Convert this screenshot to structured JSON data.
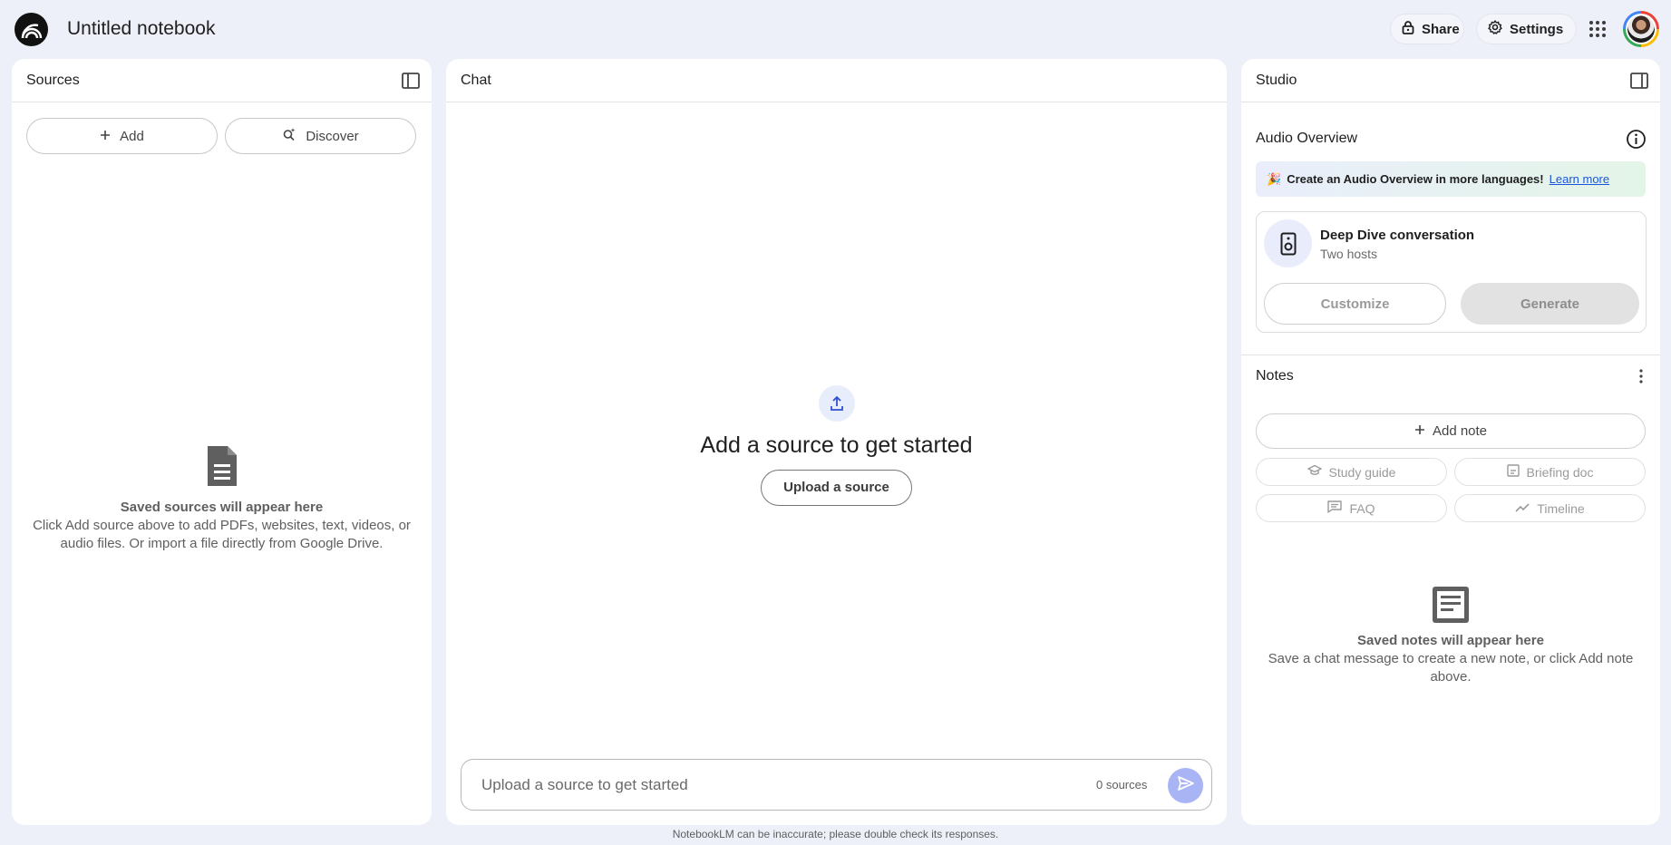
{
  "header": {
    "notebook_title": "Untitled notebook",
    "share_label": "Share",
    "settings_label": "Settings"
  },
  "sources": {
    "title": "Sources",
    "add_label": "Add",
    "discover_label": "Discover",
    "empty_title": "Saved sources will appear here",
    "empty_desc": "Click Add source above to add PDFs, websites, text, videos, or audio files. Or import a file directly from Google Drive."
  },
  "chat": {
    "title": "Chat",
    "headline": "Add a source to get started",
    "upload_label": "Upload a source",
    "input_placeholder": "Upload a source to get started",
    "source_count": "0 sources",
    "footer_note": "NotebookLM can be inaccurate; please double check its responses."
  },
  "studio": {
    "title": "Studio",
    "audio_overview_title": "Audio Overview",
    "promo_emoji": "🎉",
    "promo_text": "Create an Audio Overview in more languages!",
    "promo_link": "Learn more",
    "deep_dive_title": "Deep Dive conversation",
    "deep_dive_sub": "Two hosts",
    "customize_label": "Customize",
    "generate_label": "Generate",
    "notes_title": "Notes",
    "add_note_label": "Add note",
    "chips": {
      "study_guide": "Study guide",
      "briefing_doc": "Briefing doc",
      "faq": "FAQ",
      "timeline": "Timeline"
    },
    "notes_empty_title": "Saved notes will appear here",
    "notes_empty_desc": "Save a chat message to create a new note, or click Add note above."
  },
  "colors": {
    "background": "#eef0f9",
    "accent_send": "#a8b4f4",
    "link": "#1a56db"
  },
  "icons": {
    "logo": "notebooklm-logo-icon",
    "share": "lock-icon",
    "settings": "gear-icon",
    "apps": "apps-grid-icon",
    "panel_toggle": "panel-toggle-icon",
    "add": "plus-icon",
    "discover": "discover-search-icon",
    "document": "document-icon",
    "upload": "upload-icon",
    "send": "send-icon",
    "info": "info-icon",
    "speaker": "speaker-icon",
    "more": "more-vert-icon"
  }
}
